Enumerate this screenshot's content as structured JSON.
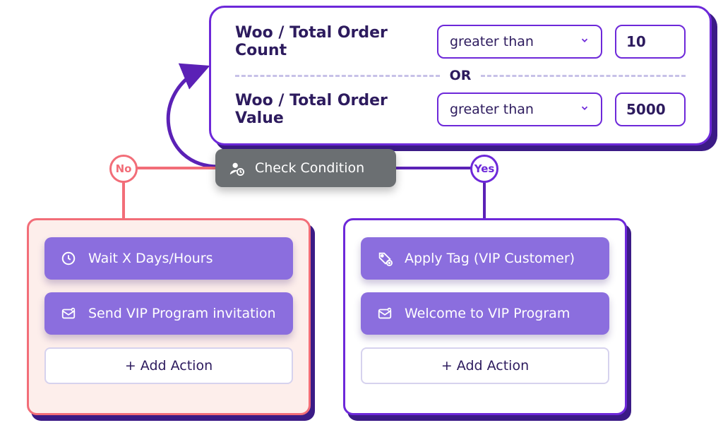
{
  "condition_panel": {
    "rows": [
      {
        "label": "Woo / Total Order Count",
        "operator": "greater than",
        "value": "10"
      },
      {
        "label": "Woo / Total Order Value",
        "operator": "greater than",
        "value": "5000"
      }
    ],
    "join": "OR"
  },
  "center_node": {
    "label": "Check Condition"
  },
  "badges": {
    "no": "No",
    "yes": "Yes"
  },
  "branch_no": {
    "actions": [
      {
        "icon": "clock-icon",
        "label": "Wait X Days/Hours"
      },
      {
        "icon": "mail-icon",
        "label": "Send VIP Program invitation"
      }
    ],
    "add_label": "+ Add Action"
  },
  "branch_yes": {
    "actions": [
      {
        "icon": "tag-icon",
        "label": "Apply Tag (VIP Customer)"
      },
      {
        "icon": "mail-icon",
        "label": "Welcome to VIP Program"
      }
    ],
    "add_label": "+ Add Action"
  }
}
